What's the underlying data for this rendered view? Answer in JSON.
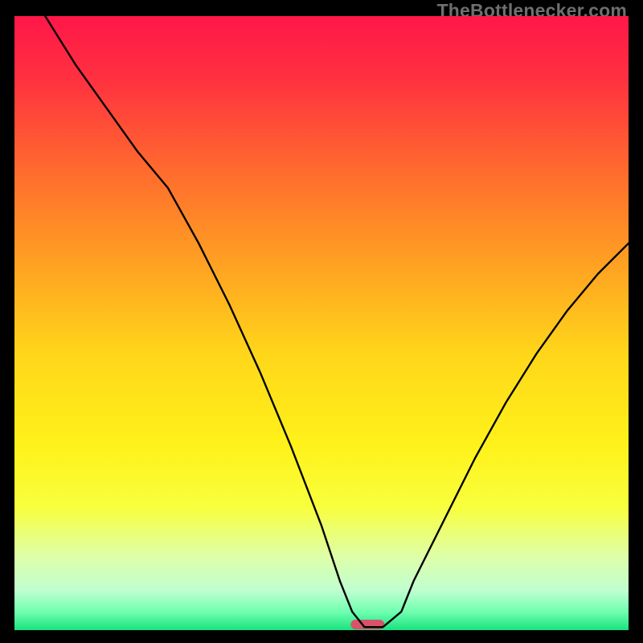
{
  "watermark": "TheBottlenecker.com",
  "chart_data": {
    "type": "line",
    "title": "",
    "xlabel": "",
    "ylabel": "",
    "xlim": [
      0,
      100
    ],
    "ylim": [
      0,
      100
    ],
    "gradient_stops": [
      {
        "offset": 0.0,
        "color": "#ff1749"
      },
      {
        "offset": 0.1,
        "color": "#ff3040"
      },
      {
        "offset": 0.25,
        "color": "#ff6a2e"
      },
      {
        "offset": 0.4,
        "color": "#ffa022"
      },
      {
        "offset": 0.55,
        "color": "#ffd61a"
      },
      {
        "offset": 0.7,
        "color": "#fff21a"
      },
      {
        "offset": 0.8,
        "color": "#f8ff3e"
      },
      {
        "offset": 0.88,
        "color": "#deffa8"
      },
      {
        "offset": 0.935,
        "color": "#c0ffd0"
      },
      {
        "offset": 0.97,
        "color": "#70ffb0"
      },
      {
        "offset": 1.0,
        "color": "#19e27e"
      }
    ],
    "series": [
      {
        "name": "bottleneck-curve",
        "x": [
          5,
          10,
          15,
          20,
          25,
          30,
          35,
          40,
          45,
          50,
          53,
          55,
          57,
          59,
          60,
          63,
          65,
          70,
          75,
          80,
          85,
          90,
          95,
          100
        ],
        "y": [
          100,
          92,
          85,
          78,
          72,
          63,
          53,
          42,
          30,
          17,
          8,
          3,
          0.5,
          0.5,
          0.5,
          3,
          8,
          18,
          28,
          37,
          45,
          52,
          58,
          63
        ]
      }
    ],
    "marker": {
      "name": "optimal-marker",
      "x_center": 57.5,
      "width": 5.5,
      "color": "#d6536a"
    }
  }
}
